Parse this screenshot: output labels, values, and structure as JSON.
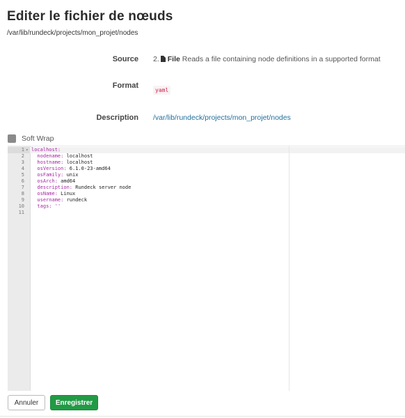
{
  "page": {
    "title": "Editer le fichier de nœuds",
    "path": "/var/lib/rundeck/projects/mon_projet/nodes"
  },
  "details": {
    "source_label": "Source",
    "source_number": "2.",
    "source_icon": "file-icon",
    "source_type": "File",
    "source_description": "Reads a file containing node definitions in a supported format",
    "format_label": "Format",
    "format_value": "yaml",
    "description_label": "Description",
    "description_value": "/var/lib/rundeck/projects/mon_projet/nodes"
  },
  "editor": {
    "softwrap_label": "Soft Wrap",
    "softwrap_checked": false,
    "lines": [
      {
        "n": "1",
        "fold": "▾",
        "key": "localhost:",
        "value": ""
      },
      {
        "n": "2",
        "fold": "",
        "key": "  nodename:",
        "value": " localhost"
      },
      {
        "n": "3",
        "fold": "",
        "key": "  hostname:",
        "value": " localhost"
      },
      {
        "n": "4",
        "fold": "",
        "key": "  osVersion:",
        "value": " 6.1.0-23-amd64"
      },
      {
        "n": "5",
        "fold": "",
        "key": "  osFamily:",
        "value": " unix"
      },
      {
        "n": "6",
        "fold": "",
        "key": "  osArch:",
        "value": " amd64"
      },
      {
        "n": "7",
        "fold": "",
        "key": "  description:",
        "value": " Rundeck server node"
      },
      {
        "n": "8",
        "fold": "",
        "key": "  osName:",
        "value": " Linux"
      },
      {
        "n": "9",
        "fold": "",
        "key": "  username:",
        "value": " rundeck"
      },
      {
        "n": "10",
        "fold": "",
        "key": "  tags:",
        "value": " ''"
      },
      {
        "n": "11",
        "fold": "",
        "key": "",
        "value": ""
      }
    ]
  },
  "actions": {
    "cancel_label": "Annuler",
    "save_label": "Enregistrer"
  },
  "colors": {
    "link": "#1f6f9e",
    "save_button": "#229a45",
    "yaml_key": "#a626a4"
  }
}
